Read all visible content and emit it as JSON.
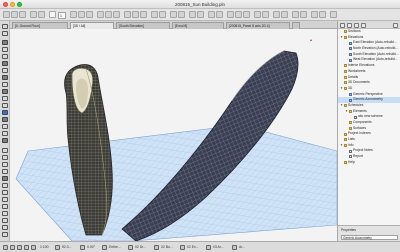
{
  "window": {
    "title": "200815_Sun Building.pln"
  },
  "toolbar": {
    "layer_combo": "",
    "zoom_field": "1"
  },
  "tabs": [
    {
      "label": "[0. Ground Floor]"
    },
    {
      "label": "[3D / All]"
    },
    {
      "label": "[South Elevation]"
    },
    {
      "label": "[Emul 8]"
    },
    {
      "label": "[200815_Panel 8 axis 2D 4]"
    }
  ],
  "navigator": {
    "items": [
      {
        "label": "Sections",
        "level": 1,
        "icon": "folder",
        "chevron": ""
      },
      {
        "label": "Elevations",
        "level": 1,
        "icon": "folder",
        "chevron": "v"
      },
      {
        "label": "East Elevation (Auto-rebuild...",
        "level": 2,
        "icon": "view",
        "chevron": ""
      },
      {
        "label": "North Elevation (Auto-rebuild...",
        "level": 2,
        "icon": "view",
        "chevron": ""
      },
      {
        "label": "South Elevation (Auto-rebuild...",
        "level": 2,
        "icon": "view",
        "chevron": ""
      },
      {
        "label": "West Elevation (Auto-rebuild...",
        "level": 2,
        "icon": "view",
        "chevron": ""
      },
      {
        "label": "Interior Elevations",
        "level": 1,
        "icon": "folder",
        "chevron": ""
      },
      {
        "label": "Worksheets",
        "level": 1,
        "icon": "folder",
        "chevron": ""
      },
      {
        "label": "Details",
        "level": 1,
        "icon": "folder",
        "chevron": ""
      },
      {
        "label": "3D Documents",
        "level": 1,
        "icon": "folder",
        "chevron": ""
      },
      {
        "label": "3D",
        "level": 1,
        "icon": "folder",
        "chevron": "v"
      },
      {
        "label": "Generic Perspective",
        "level": 2,
        "icon": "view",
        "chevron": ""
      },
      {
        "label": "Generic Axonometry",
        "level": 2,
        "icon": "view",
        "chevron": "",
        "selected": true
      },
      {
        "label": "Schedules",
        "level": 1,
        "icon": "folder",
        "chevron": "v"
      },
      {
        "label": "Elements",
        "level": 2,
        "icon": "folder",
        "chevron": "v"
      },
      {
        "label": "abc new scheme",
        "level": 3,
        "icon": "doc",
        "chevron": ""
      },
      {
        "label": "Components",
        "level": 2,
        "icon": "folder",
        "chevron": ""
      },
      {
        "label": "Surfaces",
        "level": 2,
        "icon": "folder",
        "chevron": ""
      },
      {
        "label": "Project Indexes",
        "level": 1,
        "icon": "folder",
        "chevron": ""
      },
      {
        "label": "Lists",
        "level": 1,
        "icon": "folder",
        "chevron": ""
      },
      {
        "label": "Info",
        "level": 1,
        "icon": "folder",
        "chevron": "v"
      },
      {
        "label": "Project Notes",
        "level": 2,
        "icon": "doc",
        "chevron": ""
      },
      {
        "label": "Report",
        "level": 2,
        "icon": "doc",
        "chevron": ""
      },
      {
        "label": "Help",
        "level": 1,
        "icon": "folder",
        "chevron": ""
      }
    ],
    "footer": {
      "properties_label": "Properties",
      "view_name": "Generic Axonometry"
    }
  },
  "status": {
    "undo_label": "",
    "scale": "1:100",
    "zoom_percent": "52.3...",
    "angle": "0.00°",
    "layer_combo": "Entire...",
    "pen_set": "02 Dr...",
    "model_view": "02 Bu...",
    "renovation": "02 Ex...",
    "filter": "03 Ar...",
    "extra": "Ar..."
  },
  "colors": {
    "ground_grid": "#9fc3ea",
    "tower_body": "#4b4b4b",
    "tower_trim": "#8a8a4a",
    "shell_dark": "#2d3040"
  }
}
